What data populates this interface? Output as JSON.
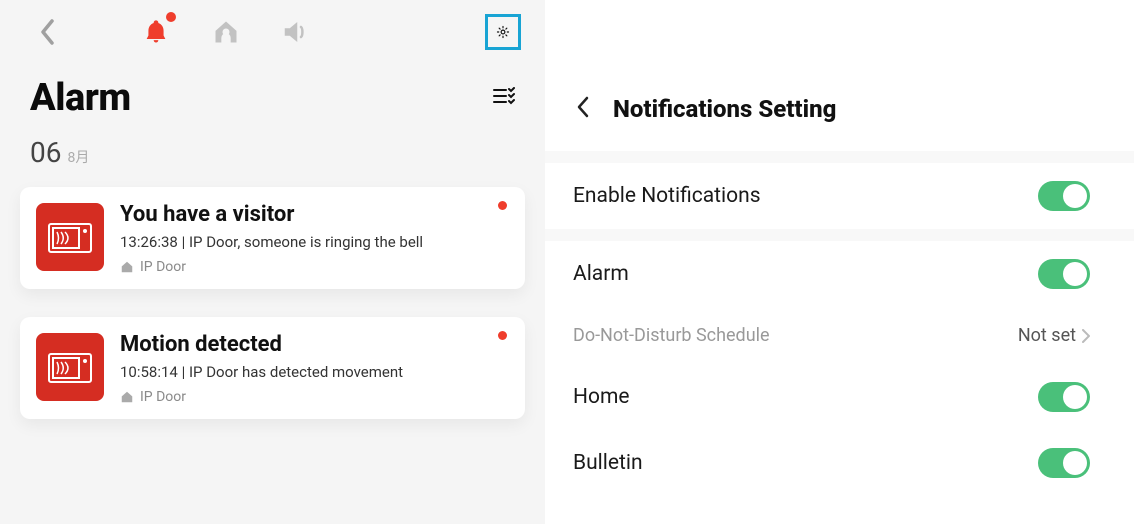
{
  "left": {
    "title": "Alarm",
    "dateNum": "06",
    "dateMonth": "8月",
    "cards": [
      {
        "title": "You have a visitor",
        "sub": "13:26:38 | IP Door, someone is ringing the bell",
        "device": "IP Door"
      },
      {
        "title": "Motion detected",
        "sub": "10:58:14 |  IP Door has detected movement",
        "device": "IP Door"
      }
    ]
  },
  "right": {
    "title": "Notifications Setting",
    "rows": {
      "enable": "Enable Notifications",
      "alarm": "Alarm",
      "dnd": "Do-Not-Disturb Schedule",
      "dndValue": "Not set",
      "home": "Home",
      "bulletin": "Bulletin"
    }
  }
}
